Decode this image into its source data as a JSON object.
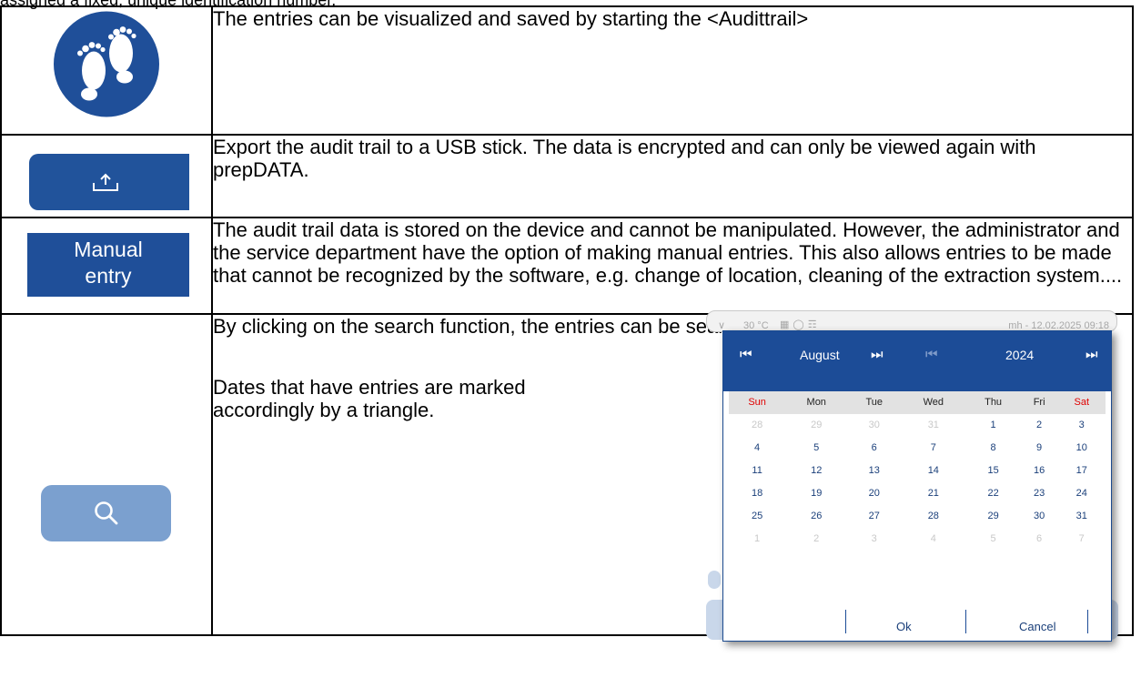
{
  "header_fragment": "assigned a fixed, unique identification number.",
  "rows": [
    {
      "icon": "footprints-icon",
      "text": "The entries can be visualized and saved by starting the <Audittrail>"
    },
    {
      "icon": "export-upload-icon",
      "text": "Export the audit trail to a USB stick. The data is encrypted and can only be viewed again with prepDATA."
    },
    {
      "icon_label": "Manual entry",
      "text": "The audit trail data is stored on the device and cannot be manipulated. However, the administrator and the service department have the option of making manual entries. This also allows entries to be made that cannot be recognized by the software, e.g. change of location, cleaning of the extraction system...."
    },
    {
      "icon": "search-icon",
      "text1": "By clicking on the search function, the entries can be searched for easily, using a calendar.",
      "text2": "Dates that have entries are marked accordingly by a triangle."
    }
  ],
  "calendar": {
    "status_temp": "30 °C",
    "status_user": "mh - 12.02.2025 09:18",
    "month": "August",
    "year": "2024",
    "weekdays": [
      "Sun",
      "Mon",
      "Tue",
      "Wed",
      "Thu",
      "Fri",
      "Sat"
    ],
    "weeks": [
      [
        "28",
        "29",
        "30",
        "31",
        "1",
        "2",
        "3"
      ],
      [
        "4",
        "5",
        "6",
        "7",
        "8",
        "9",
        "10"
      ],
      [
        "11",
        "12",
        "13",
        "14",
        "15",
        "16",
        "17"
      ],
      [
        "18",
        "19",
        "20",
        "21",
        "22",
        "23",
        "24"
      ],
      [
        "25",
        "26",
        "27",
        "28",
        "29",
        "30",
        "31"
      ],
      [
        "1",
        "2",
        "3",
        "4",
        "5",
        "6",
        "7"
      ]
    ],
    "ok_label": "Ok",
    "cancel_label": "Cancel",
    "bg_button_label": "entry"
  },
  "colors": {
    "button_blue": "#1f4f99",
    "search_blue": "#7ba0cf",
    "weekend_red": "#e00000"
  }
}
